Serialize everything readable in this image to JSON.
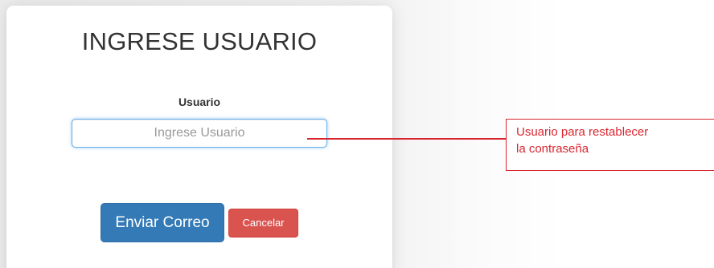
{
  "form": {
    "title": "INGRESE USUARIO",
    "field_label": "Usuario",
    "input_value": "",
    "input_placeholder": "Ingrese Usuario",
    "send_label": "Enviar Correo",
    "cancel_label": "Cancelar"
  },
  "annotation": {
    "line1": "Usuario para restablecer",
    "line2": "la contraseña"
  },
  "colors": {
    "primary_button": "#337ab7",
    "danger_button": "#d9534f",
    "annotation": "#d9252f",
    "input_focus_border": "#66afe9"
  }
}
